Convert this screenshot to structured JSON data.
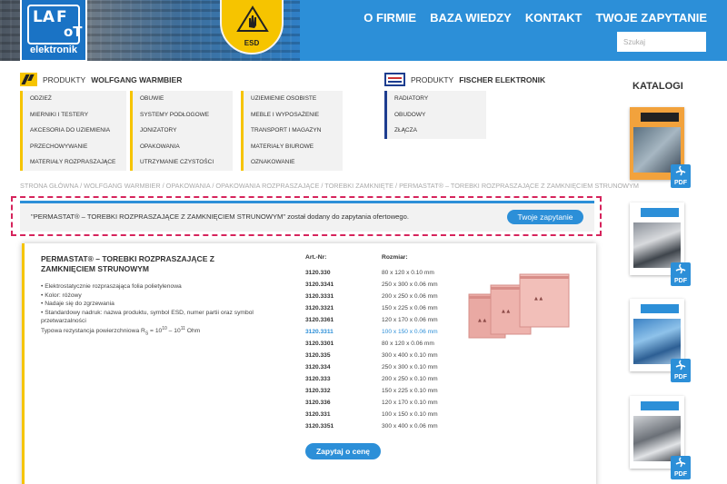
{
  "header": {
    "logo_text": "elektronik",
    "esd_label": "ESD",
    "nav": [
      "O FIRMIE",
      "BAZA WIEDZY",
      "KONTAKT",
      "TWOJE ZAPYTANIE"
    ],
    "search_placeholder": "Szukaj"
  },
  "menus": {
    "warmbier": {
      "prefix": "PRODUKTY",
      "brand": "WOLFGANG WARMBIER",
      "col1": [
        "ODZIEŻ",
        "MIERNIKI I TESTERY",
        "AKCESORIA DO UZIEMIENIA",
        "PRZECHOWYWANIE",
        "MATERIAŁY ROZPRASZAJĄCE"
      ],
      "col2": [
        "OBUWIE",
        "SYSTEMY PODŁOGOWE",
        "JONIZATORY",
        "OPAKOWANIA",
        "UTRZYMANIE CZYSTOŚCI"
      ],
      "col3": [
        "UZIEMIENIE OSOBISTE",
        "MEBLE I WYPOSAŻENIE",
        "TRANSPORT I MAGAZYN",
        "MATERIAŁY BIUROWE",
        "OZNAKOWANIE"
      ]
    },
    "fischer": {
      "prefix": "PRODUKTY",
      "brand": "FISCHER ELEKTRONIK",
      "col1": [
        "RADIATORY",
        "OBUDOWY",
        "ZŁĄCZA"
      ]
    }
  },
  "breadcrumb": "STRONA GŁÓWNA / WOLFGANG WARMBIER / OPAKOWANIA / OPAKOWANIA ROZPRASZAJĄCE / TOREBKI ZAMKNIĘTE / PERMASTAT® – TOREBKI ROZPRASZAJĄCE Z ZAMKNIĘCIEM STRUNOWYM",
  "notice": {
    "text": "\"PERMASTAT® – TOREBKI ROZPRASZAJĄCE Z ZAMKNIĘCIEM STRUNOWYM\" został dodany do zapytania ofertowego.",
    "button": "Twoje zapytanie"
  },
  "product": {
    "title": "PERMASTAT® – TOREBKI ROZPRASZAJĄCE Z ZAMKNIĘCIEM STRUNOWYM",
    "features": [
      "Elektrostatycznie rozpraszająca folia polietylenowa",
      "Kolor: różowy",
      "Nadaje się do zgrzewania",
      "Standardowy nadruk: nazwa produktu, symbol ESD, numer partii oraz symbol przetwarzalności"
    ],
    "resistance": {
      "label": "Typowa rezystancja powierzchniowa R",
      "sub": "S",
      "eq": " = 10",
      "exp1": "10",
      "dash": " – 10",
      "exp2": "11",
      "unit": " Ohm"
    },
    "col_art": "Art.-Nr:",
    "col_size": "Rozmiar:",
    "rows": [
      {
        "art": "3120.330",
        "size": "80 x 120 x 0.10 mm"
      },
      {
        "art": "3120.3341",
        "size": "250 x 300 x 0.06 mm"
      },
      {
        "art": "3120.3331",
        "size": "200 x 250 x 0.06 mm"
      },
      {
        "art": "3120.3321",
        "size": "150 x 225 x 0.06 mm"
      },
      {
        "art": "3120.3361",
        "size": "120 x 170 x 0.06 mm"
      },
      {
        "art": "3120.3311",
        "size": "100 x 150 x 0.06 mm",
        "highlight": true
      },
      {
        "art": "3120.3301",
        "size": "80 x 120 x 0.06 mm"
      },
      {
        "art": "3120.335",
        "size": "300 x 400 x 0.10 mm"
      },
      {
        "art": "3120.334",
        "size": "250 x 300 x 0.10 mm"
      },
      {
        "art": "3120.333",
        "size": "200 x 250 x 0.10 mm"
      },
      {
        "art": "3120.332",
        "size": "150 x 225 x 0.10 mm"
      },
      {
        "art": "3120.336",
        "size": "120 x 170 x 0.10 mm"
      },
      {
        "art": "3120.331",
        "size": "100 x 150 x 0.10 mm"
      },
      {
        "art": "3120.3351",
        "size": "300 x 400 x 0.06 mm"
      }
    ],
    "price_button": "Zapytaj o cenę"
  },
  "catalog": {
    "title": "KATALOGI",
    "pdf_label": "PDF",
    "covers": [
      "warmbier-catalog",
      "fischer-catalog-1",
      "fischer-catalog-2",
      "fischer-catalog-3"
    ]
  },
  "colors": {
    "brand_blue": "#2c8fd8",
    "brand_yellow": "#f6c400",
    "highlight_dashed": "#d6245c",
    "fischer_navy": "#1d3d8f"
  }
}
